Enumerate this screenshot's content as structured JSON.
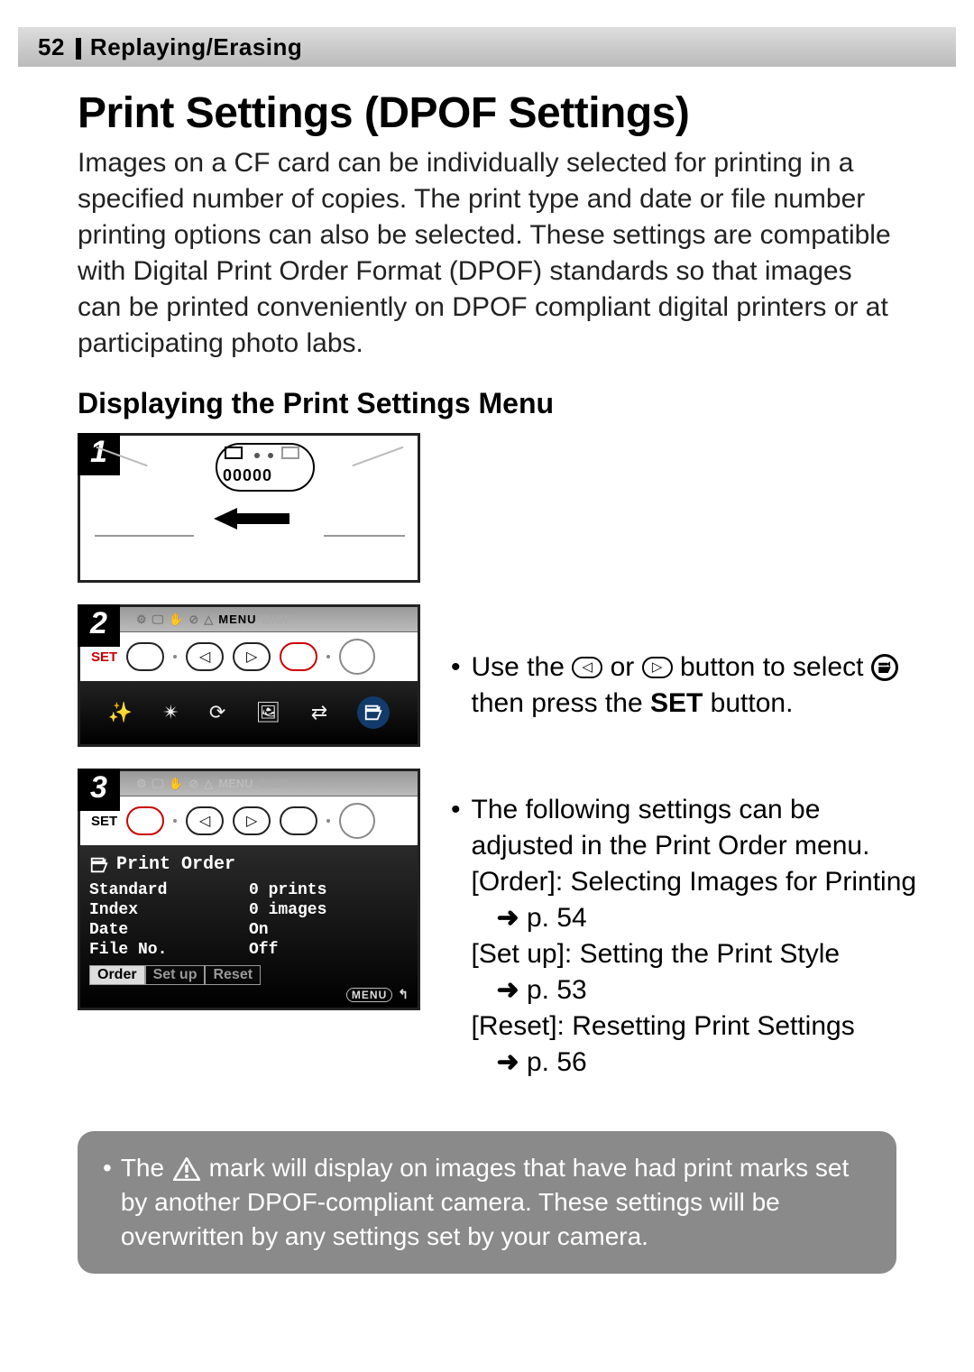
{
  "header": {
    "page_number": "52",
    "section": "Replaying/Erasing"
  },
  "title": "Print Settings (DPOF Settings)",
  "intro": "Images on a CF card can be individually selected for printing in a specified number of copies. The print type and date or file number printing options can also be selected. These settings are compatible with Digital Print Order Format (DPOF) standards so that images can be printed conveniently on DPOF compliant digital printers or at participating photo labs.",
  "subhead": "Displaying the Print Settings Menu",
  "steps": {
    "one": "1",
    "two": "2",
    "three": "3"
  },
  "fig1": {
    "counter": "00000"
  },
  "strip": {
    "set_label": "SET",
    "menu_label": "MENU",
    "disp_label": "DISP"
  },
  "lcd": {
    "title": "Print Order",
    "rows": [
      {
        "label": "Standard",
        "value": "0 prints"
      },
      {
        "label": "Index",
        "value": "0 images"
      },
      {
        "label": "Date",
        "value": "On"
      },
      {
        "label": "File No.",
        "value": "Off"
      }
    ],
    "tabs": {
      "order": "Order",
      "setup": "Set up",
      "reset": "Reset"
    },
    "menu_pill": "MENU",
    "back_glyph": "↰"
  },
  "right": {
    "bullet2_a": "Use the ",
    "bullet2_b": " or ",
    "bullet2_c": " button to select ",
    "bullet2_d": "then press the ",
    "bullet2_set": "SET",
    "bullet2_e": " button.",
    "bullet3_intro": "The following settings can be adjusted in the Print Order menu.",
    "bullet3_items": [
      {
        "label": "[Order]: Selecting Images for Printing",
        "ref": "p. 54"
      },
      {
        "label": "[Set up]: Setting the Print Style",
        "ref": "p. 53"
      },
      {
        "label": "[Reset]: Resetting Print Settings",
        "ref": "p. 56"
      }
    ],
    "arrow": "➜"
  },
  "note": {
    "a": "The ",
    "b": " mark will display on images that have had print marks set by another DPOF-compliant camera. These settings will be overwritten by any settings set by your camera."
  }
}
